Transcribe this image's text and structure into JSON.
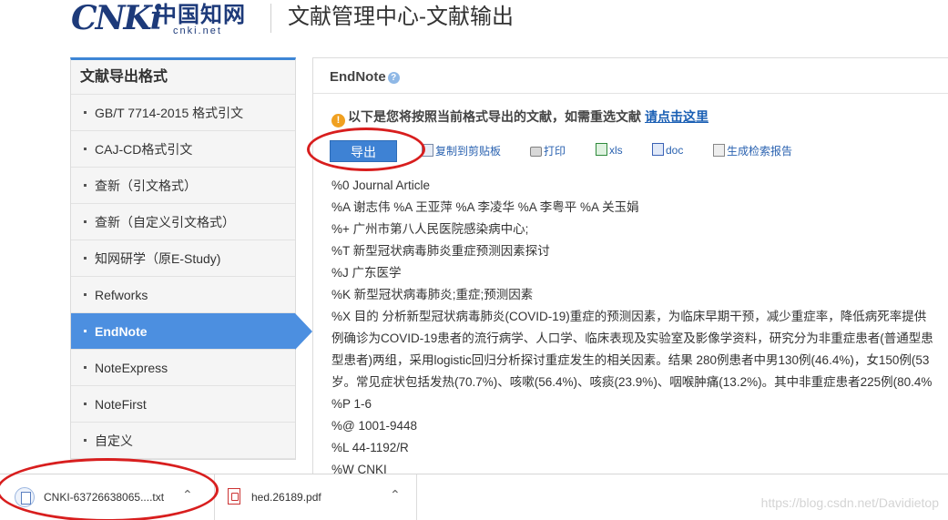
{
  "header": {
    "logo_mark": "CNKi",
    "logo_cn": "中国知网",
    "logo_domain": "cnki.net",
    "title": "文献管理中心-文献输出"
  },
  "sidebar": {
    "title": "文献导出格式",
    "items": [
      {
        "label": "GB/T 7714-2015 格式引文",
        "active": false
      },
      {
        "label": "CAJ-CD格式引文",
        "active": false
      },
      {
        "label": "查新（引文格式）",
        "active": false
      },
      {
        "label": "查新（自定义引文格式）",
        "active": false
      },
      {
        "label": "知网研学（原E-Study)",
        "active": false
      },
      {
        "label": "Refworks",
        "active": false
      },
      {
        "label": "EndNote",
        "active": true
      },
      {
        "label": "NoteExpress",
        "active": false
      },
      {
        "label": "NoteFirst",
        "active": false
      },
      {
        "label": "自定义",
        "active": false
      }
    ]
  },
  "main": {
    "format_title": "EndNote",
    "help_icon": "?",
    "notice_icon": "!",
    "notice_text": "以下是您将按照当前格式导出的文献，如需重选文献",
    "notice_link": "请点击这里",
    "toolbar": {
      "export": "导出",
      "copy": "复制到剪贴板",
      "print": "打印",
      "xls": "xls",
      "doc": "doc",
      "report": "生成检索报告"
    },
    "lines": [
      "%0 Journal Article",
      "%A 谢志伟 %A 王亚萍 %A 李凌华 %A 李粤平 %A 关玉娟",
      "%+ 广州市第八人民医院感染病中心;",
      "%T 新型冠状病毒肺炎重症预测因素探讨",
      "%J 广东医学",
      "%K 新型冠状病毒肺炎;重症;预测因素",
      "%X 目的 分析新型冠状病毒肺炎(COVID-19)重症的预测因素，为临床早期干预，减少重症率，降低病死率提供",
      "例确诊为COVID-19患者的流行病学、人口学、临床表现及实验室及影像学资料，研究分为非重症患者(普通型患",
      "型患者)两组，采用logistic回归分析探讨重症发生的相关因素。结果 280例患者中男130例(46.4%)，女150例(53",
      "岁。常见症状包括发热(70.7%)、咳嗽(56.4%)、咳痰(23.9%)、咽喉肿痛(13.2%)。其中非重症患者225例(80.4%",
      "%P 1-6",
      "%@ 1001-9448",
      "%L 44-1192/R",
      "%W CNKI"
    ]
  },
  "downloads": [
    {
      "name": "CNKI-63726638065....txt",
      "icon": "text-file-icon"
    },
    {
      "name": "hed.26189.pdf",
      "icon": "pdf-file-icon"
    }
  ],
  "watermark": "https://blog.csdn.net/Davidietop",
  "colors": {
    "accent": "#4c8fe0",
    "export_button": "#3e82d4",
    "highlight_circle": "#d81e1e",
    "link": "#1a5fb4"
  }
}
